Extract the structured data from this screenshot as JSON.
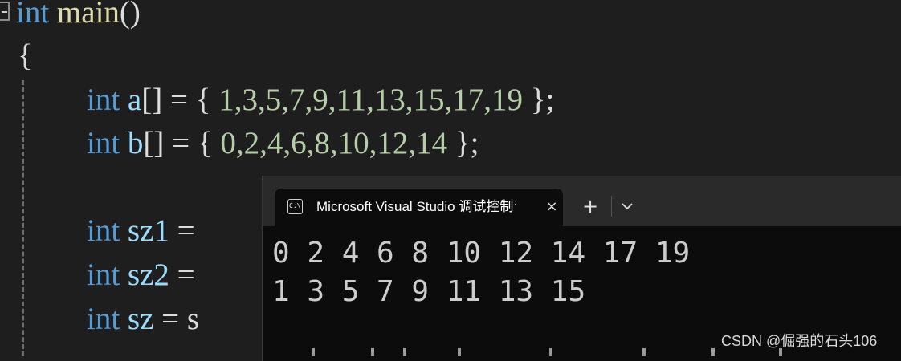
{
  "editor": {
    "lines": [
      {
        "kw": "int",
        "fn": "main",
        "rest": "()"
      },
      {
        "open": "{"
      },
      {
        "kw": "int",
        "var": "a",
        "brackets": "[]",
        "eq": " = { ",
        "nums": "1,3,5,7,9,11,13,15,17,19",
        "close": " };"
      },
      {
        "kw": "int",
        "var": "b",
        "brackets": "[]",
        "eq": " = { ",
        "nums": "0,2,4,6,8,10,12,14",
        "close": " };"
      },
      {
        "kw": "int",
        "var": "sz1",
        "eq": " ="
      },
      {
        "kw": "int",
        "var": "sz2",
        "eq": " ="
      },
      {
        "kw": "int",
        "var": "sz",
        "eq": " = s"
      }
    ]
  },
  "terminal": {
    "tab_title": "Microsoft Visual Studio 调试控制台",
    "icon_text": "C:\\",
    "close_glyph": "×",
    "new_tab_glyph": "+",
    "output": [
      "0 2 4 6 8 10 12 14 17 19",
      "1 3 5 7 9 11 13 15"
    ]
  },
  "watermark": "CSDN @倔强的石头106"
}
